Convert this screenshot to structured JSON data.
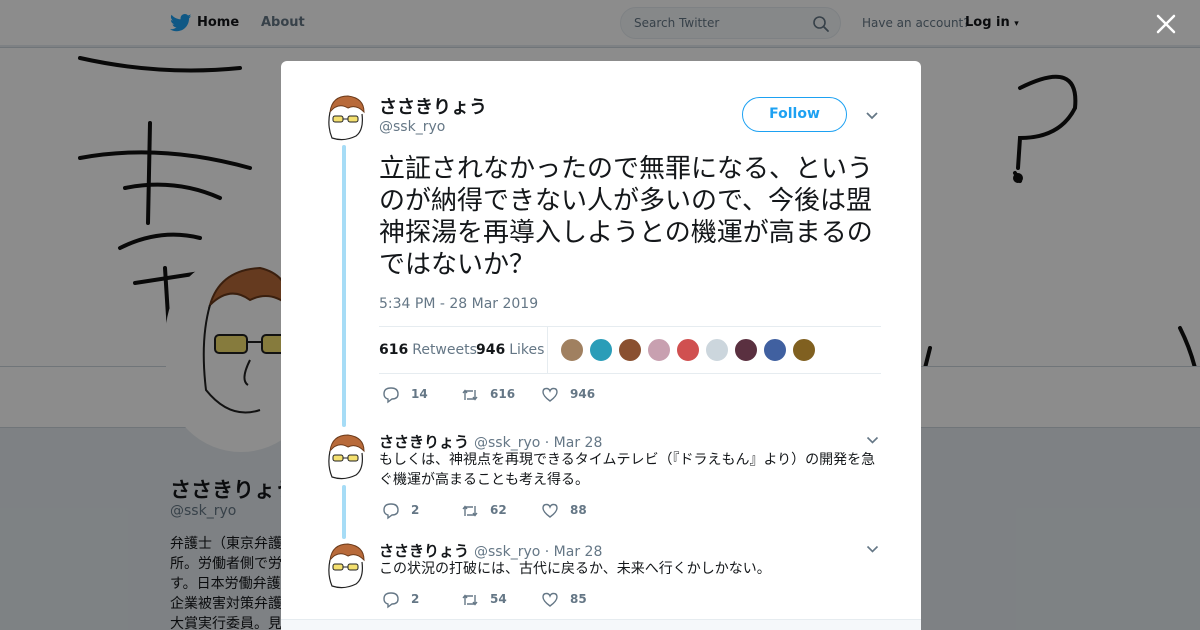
{
  "topbar": {
    "home_label": "Home",
    "about_label": "About",
    "search_placeholder": "Search Twitter",
    "have_account": "Have an account?",
    "login_label": "Log in"
  },
  "profile": {
    "name": "ささきりょう",
    "handle": "@ssk_ryo",
    "bio_lines": [
      "弁護士（東京弁護",
      "所。労働者側で労",
      "す。日本労働弁護",
      "企業被害対策弁護",
      "大賞実行委員。見"
    ]
  },
  "tweet": {
    "author_name": "ささきりょう",
    "author_handle": "@ssk_ryo",
    "follow_label": "Follow",
    "text": "立証されなかったので無罪になる、というのが納得できない人が多いので、今後は盟神探湯を再導入しようとの機運が高まるのではないか？",
    "timestamp": "5:34 PM - 28 Mar 2019",
    "retweets_count": "616",
    "retweets_label": "Retweets",
    "likes_count": "946",
    "likes_label": "Likes",
    "actions": {
      "replies": "14",
      "retweets": "616",
      "likes": "946"
    }
  },
  "liker_faces": [
    {
      "color": "#a08060"
    },
    {
      "color": "#2a9db8"
    },
    {
      "color": "#8a5030"
    },
    {
      "color": "#c8a0b0"
    },
    {
      "color": "#d05050"
    },
    {
      "color": "#ccd6dd"
    },
    {
      "color": "#5a3040"
    },
    {
      "color": "#4060a0"
    },
    {
      "color": "#806020"
    }
  ],
  "replies": [
    {
      "name": "ささきりょう",
      "handle": "@ssk_ryo",
      "date": "· Mar 28",
      "text": "もしくは、神視点を再現できるタイムテレビ（『ドラえもん』より）の開発を急ぐ機運が高まることも考え得る。",
      "replies": "2",
      "retweets": "62",
      "likes": "88"
    },
    {
      "name": "ささきりょう",
      "handle": "@ssk_ryo",
      "date": "· Mar 28",
      "text": "この状況の打破には、古代に戻るか、未来へ行くかしかない。",
      "replies": "2",
      "retweets": "54",
      "likes": "85"
    }
  ],
  "colors": {
    "accent": "#1da1f2",
    "thread_line": "#a6dcf6",
    "muted": "#657786"
  }
}
